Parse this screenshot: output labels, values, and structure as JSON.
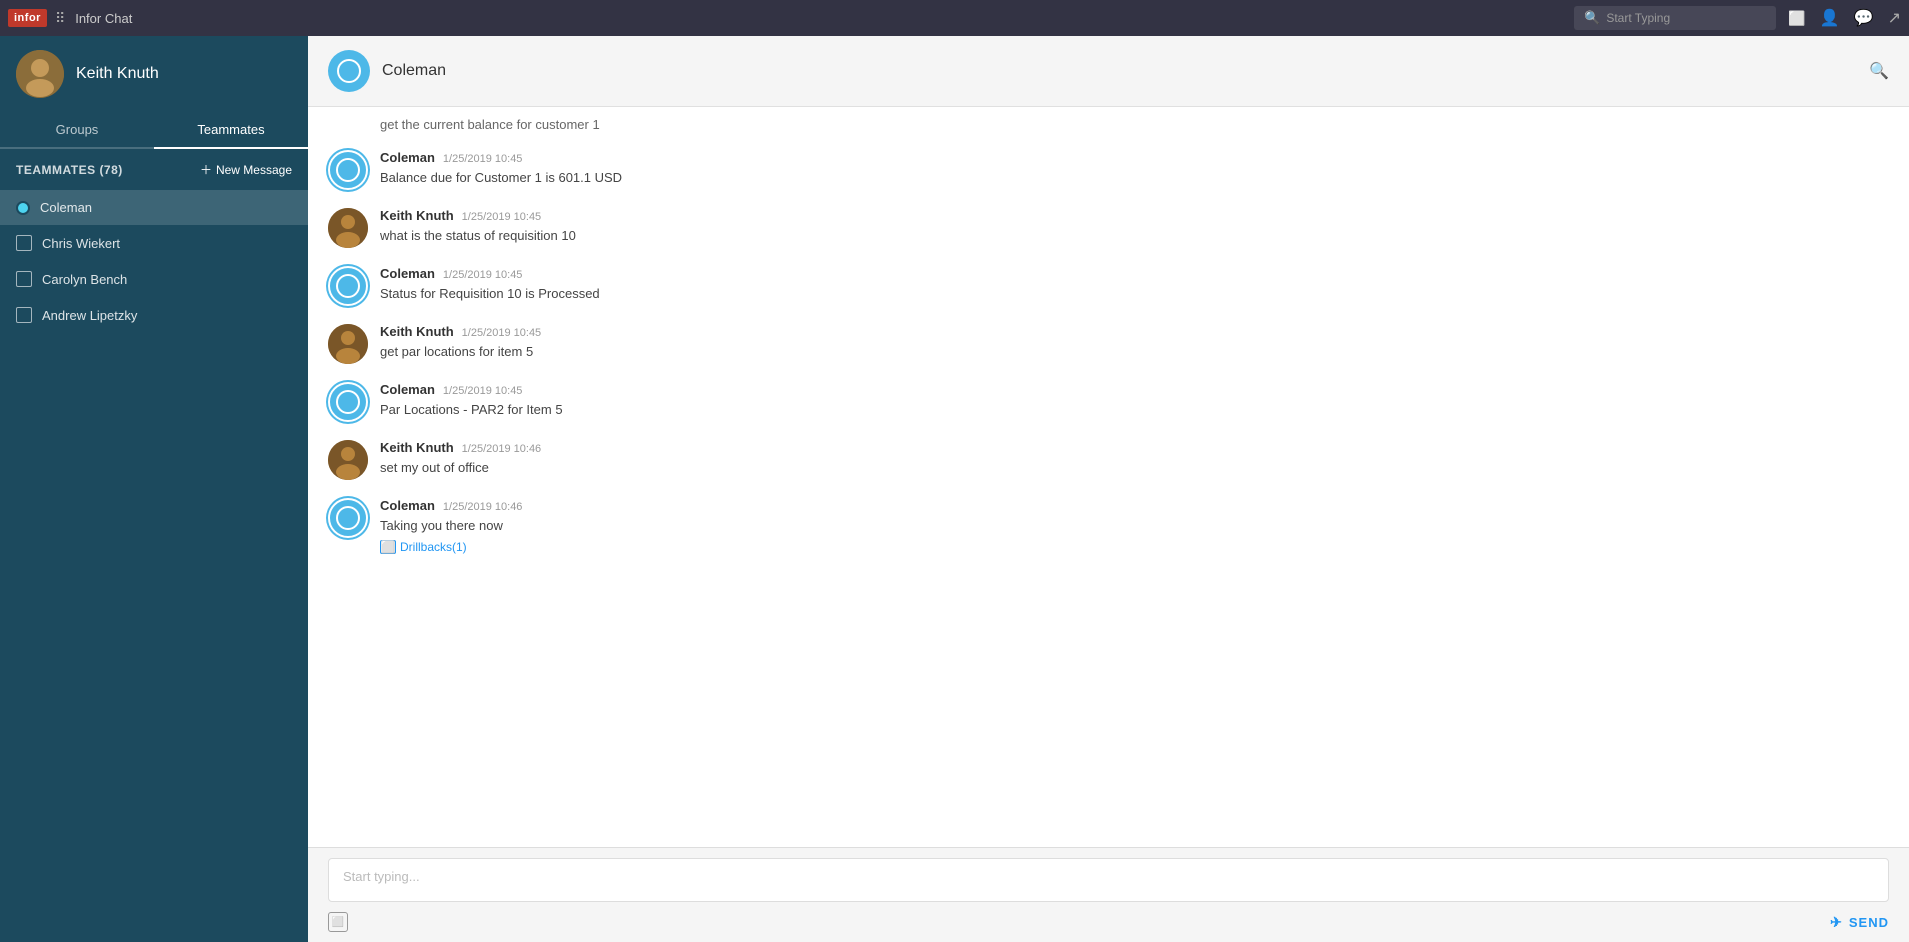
{
  "topNav": {
    "logoText": "infor",
    "appTitle": "Infor Chat",
    "searchPlaceholder": "Start Typing",
    "icons": [
      "screen-icon",
      "person-icon",
      "chat-icon",
      "share-icon"
    ]
  },
  "sidebar": {
    "userName": "Keith Knuth",
    "tabs": [
      {
        "label": "Groups",
        "active": false
      },
      {
        "label": "Teammates",
        "active": true
      }
    ],
    "teammatesLabel": "TEAMMATES (78)",
    "newMessageLabel": "New Message",
    "contacts": [
      {
        "name": "Coleman",
        "active": true,
        "online": true
      },
      {
        "name": "Chris Wiekert",
        "active": false,
        "online": false
      },
      {
        "name": "Carolyn Bench",
        "active": false,
        "online": false
      },
      {
        "name": "Andrew Lipetzky",
        "active": false,
        "online": false
      }
    ]
  },
  "chat": {
    "recipientName": "Coleman",
    "messages": [
      {
        "sender": "user",
        "name": "Keith Knuth",
        "time": "",
        "text": "get the current balance for customer 1",
        "partial": true
      },
      {
        "sender": "bot",
        "name": "Coleman",
        "time": "1/25/2019 10:45",
        "text": "Balance due for Customer 1 is 601.1 USD"
      },
      {
        "sender": "user",
        "name": "Keith Knuth",
        "time": "1/25/2019 10:45",
        "text": "what is the status of requisition 10"
      },
      {
        "sender": "bot",
        "name": "Coleman",
        "time": "1/25/2019 10:45",
        "text": "Status for Requisition 10 is Processed"
      },
      {
        "sender": "user",
        "name": "Keith Knuth",
        "time": "1/25/2019 10:45",
        "text": "get par locations for item 5"
      },
      {
        "sender": "bot",
        "name": "Coleman",
        "time": "1/25/2019 10:45",
        "text": "Par Locations - PAR2 for Item 5"
      },
      {
        "sender": "user",
        "name": "Keith Knuth",
        "time": "1/25/2019 10:46",
        "text": "set my out of office"
      },
      {
        "sender": "bot",
        "name": "Coleman",
        "time": "1/25/2019 10:46",
        "text": "Taking you there now",
        "drillbacks": "Drillbacks(1)"
      }
    ],
    "inputPlaceholder": "Start typing...",
    "sendLabel": "SEND"
  }
}
